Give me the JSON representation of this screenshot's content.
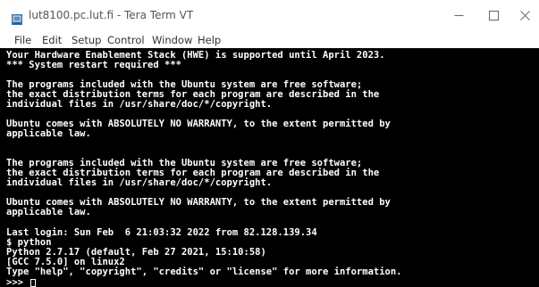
{
  "window": {
    "title": "lut8100.pc.lut.fi - Tera Term VT",
    "controls": {
      "minimize": "minimize-icon",
      "maximize": "maximize-icon",
      "close": "close-icon"
    },
    "app_icon": "teraterm-app-icon"
  },
  "menu": [
    "File",
    "Edit",
    "Setup",
    "Control",
    "Window",
    "Help"
  ],
  "terminal": {
    "background": "#000000",
    "foreground": "#ffffff",
    "lines": [
      "Your Hardware Enablement Stack (HWE) is supported until April 2023.",
      "*** System restart required ***",
      "",
      "The programs included with the Ubuntu system are free software;",
      "the exact distribution terms for each program are described in the",
      "individual files in /usr/share/doc/*/copyright.",
      "",
      "Ubuntu comes with ABSOLUTELY NO WARRANTY, to the extent permitted by",
      "applicable law.",
      "",
      "",
      "The programs included with the Ubuntu system are free software;",
      "the exact distribution terms for each program are described in the",
      "individual files in /usr/share/doc/*/copyright.",
      "",
      "Ubuntu comes with ABSOLUTELY NO WARRANTY, to the extent permitted by",
      "applicable law.",
      "",
      "Last login: Sun Feb  6 21:03:32 2022 from 82.128.139.34",
      "$ python",
      "Python 2.7.17 (default, Feb 27 2021, 15:10:58)",
      "[GCC 7.5.0] on linux2",
      "Type \"help\", \"copyright\", \"credits\" or \"license\" for more information."
    ],
    "prompt": ">>> "
  }
}
